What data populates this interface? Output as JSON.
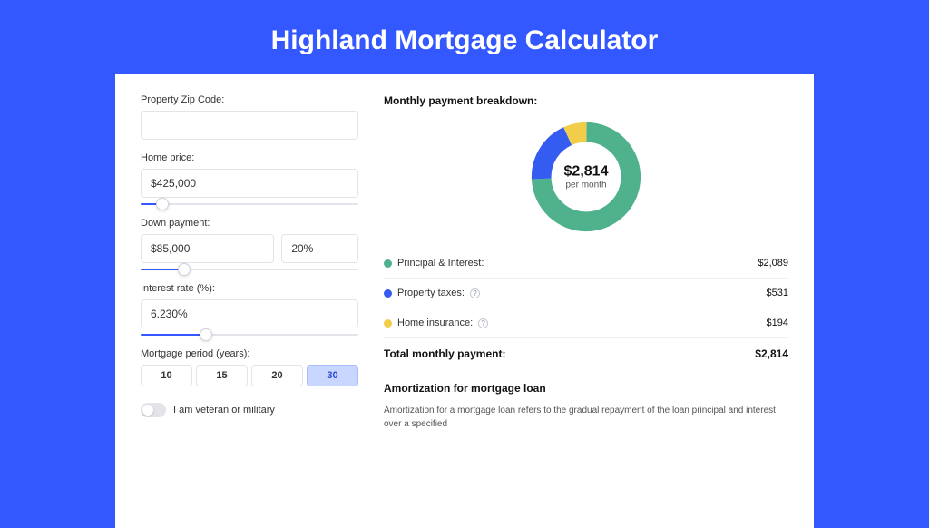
{
  "title": "Highland Mortgage Calculator",
  "form": {
    "zip": {
      "label": "Property Zip Code:",
      "value": ""
    },
    "home_price": {
      "label": "Home price:",
      "value": "$425,000",
      "slider_pct": 10
    },
    "down_payment": {
      "label": "Down payment:",
      "value": "$85,000",
      "pct_value": "20%",
      "slider_pct": 20
    },
    "interest_rate": {
      "label": "Interest rate (%):",
      "value": "6.230%",
      "slider_pct": 30
    },
    "period": {
      "label": "Mortgage period (years):",
      "options": [
        "10",
        "15",
        "20",
        "30"
      ],
      "selected": "30"
    },
    "veteran": {
      "label": "I am veteran or military",
      "checked": false
    }
  },
  "breakdown": {
    "title": "Monthly payment breakdown:",
    "center_amount": "$2,814",
    "center_sub": "per month",
    "items": [
      {
        "label": "Principal & Interest:",
        "value": "$2,089",
        "color": "#4fb28d",
        "help": false,
        "num": 2089
      },
      {
        "label": "Property taxes:",
        "value": "$531",
        "color": "#345cf0",
        "help": true,
        "num": 531
      },
      {
        "label": "Home insurance:",
        "value": "$194",
        "color": "#f2cd4a",
        "help": true,
        "num": 194
      }
    ],
    "total_label": "Total monthly payment:",
    "total_value": "$2,814"
  },
  "amortization": {
    "title": "Amortization for mortgage loan",
    "text": "Amortization for a mortgage loan refers to the gradual repayment of the loan principal and interest over a specified"
  },
  "chart_data": {
    "type": "pie",
    "title": "Monthly payment breakdown",
    "categories": [
      "Principal & Interest",
      "Property taxes",
      "Home insurance"
    ],
    "values": [
      2089,
      531,
      194
    ],
    "colors": [
      "#4fb28d",
      "#345cf0",
      "#f2cd4a"
    ],
    "total": 2814,
    "center_label": "$2,814 per month"
  }
}
